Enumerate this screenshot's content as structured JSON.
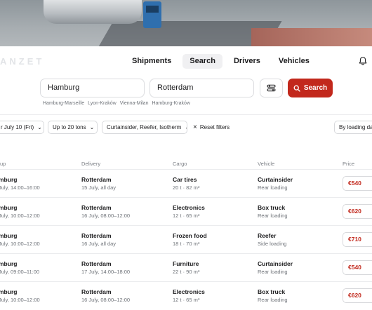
{
  "brand": "ANZET",
  "nav": {
    "tabs": [
      {
        "label": "Shipments"
      },
      {
        "label": "Search"
      },
      {
        "label": "Drivers"
      },
      {
        "label": "Vehicles"
      }
    ],
    "active_tab": "Search"
  },
  "search": {
    "from_value": "Hamburg",
    "to_value": "Rotterdam",
    "button_label": "Search",
    "recent_routes": [
      "Hamburg-Marseille",
      "Lyon-Kraków",
      "Vienna-Milan",
      "Hamburg-Kraków"
    ]
  },
  "filters": {
    "date": "r July 10 (Fri)",
    "weight": "Up to 20 tons",
    "body_types": "Curtainsider, Reefer, Isotherm",
    "reset_label": "Reset filters",
    "sort": "By loading dat"
  },
  "table": {
    "headers": {
      "pickup": "up",
      "delivery": "Delivery",
      "cargo": "Cargo",
      "vehicle": "Vehicle",
      "price": "Price"
    },
    "rows": [
      {
        "pickup_city": "mburg",
        "pickup_time": "July, 14:00–16:00",
        "delivery_city": "Rotterdam",
        "delivery_time": "15 July, all day",
        "cargo": "Car tires",
        "cargo_detail": "20 t · 82 m³",
        "vehicle": "Curtainsider",
        "loading": "Rear loading",
        "price": "€540"
      },
      {
        "pickup_city": "mburg",
        "pickup_time": "July, 10:00–12:00",
        "delivery_city": "Rotterdam",
        "delivery_time": "16 July, 08:00–12:00",
        "cargo": "Electronics",
        "cargo_detail": "12 t · 65 m³",
        "vehicle": "Box truck",
        "loading": "Rear loading",
        "price": "€620"
      },
      {
        "pickup_city": "mburg",
        "pickup_time": "July, 10:00–12:00",
        "delivery_city": "Rotterdam",
        "delivery_time": "16 July, all day",
        "cargo": "Frozen food",
        "cargo_detail": "18 t · 70 m³",
        "vehicle": "Reefer",
        "loading": "Side loading",
        "price": "€710"
      },
      {
        "pickup_city": "mburg",
        "pickup_time": "July, 09:00–11:00",
        "delivery_city": "Rotterdam",
        "delivery_time": "17 July, 14:00–18:00",
        "cargo": "Furniture",
        "cargo_detail": "22 t · 90 m³",
        "vehicle": "Curtainsider",
        "loading": "Rear loading",
        "price": "€540"
      },
      {
        "pickup_city": "mburg",
        "pickup_time": "July, 10:00–12:00",
        "delivery_city": "Rotterdam",
        "delivery_time": "16 July, 08:00–12:00",
        "cargo": "Electronics",
        "cargo_detail": "12 t · 65 m³",
        "vehicle": "Box truck",
        "loading": "Rear loading",
        "price": "€620"
      }
    ]
  },
  "colors": {
    "accent": "#c2281c",
    "text": "#1c1c1e",
    "muted": "#6e7278",
    "border": "#dcdde0"
  },
  "icons": {
    "bell": "bell-icon",
    "filter": "sliders-icon",
    "search": "search-icon",
    "chevron": "chevron-down-icon",
    "reset": "close-icon"
  }
}
